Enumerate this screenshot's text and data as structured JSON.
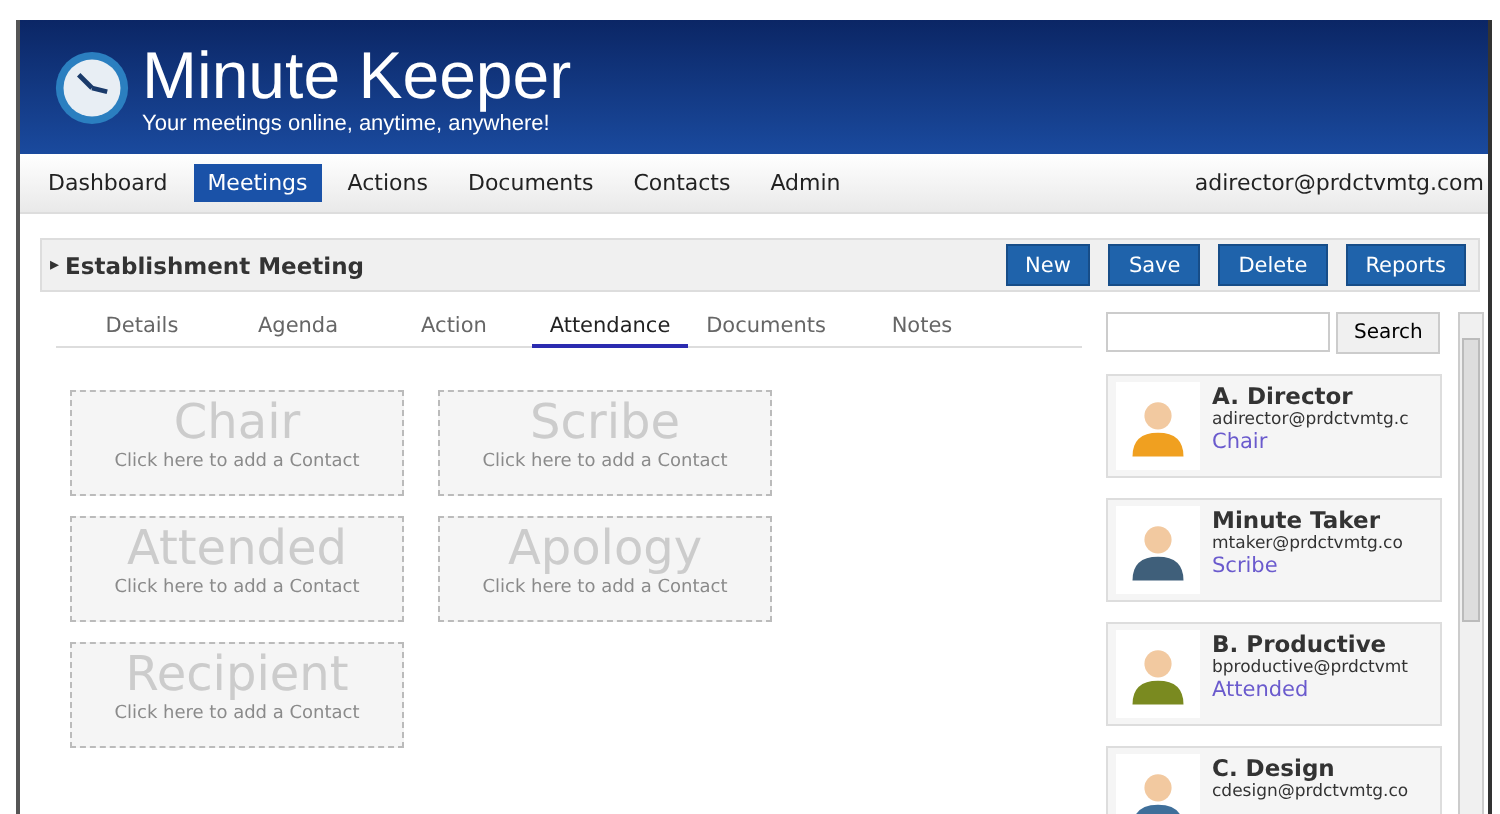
{
  "header": {
    "title": "Minute Keeper",
    "tagline": "Your meetings online, anytime, anywhere!"
  },
  "nav": {
    "items": [
      {
        "label": "Dashboard",
        "selected": false
      },
      {
        "label": "Meetings",
        "selected": true
      },
      {
        "label": "Actions",
        "selected": false
      },
      {
        "label": "Documents",
        "selected": false
      },
      {
        "label": "Contacts",
        "selected": false
      },
      {
        "label": "Admin",
        "selected": false
      }
    ],
    "user": "adirector@prdctvmtg.com"
  },
  "toolbar": {
    "toggle": "▸",
    "title": "Establishment Meeting",
    "buttons": [
      "New",
      "Save",
      "Delete",
      "Reports"
    ]
  },
  "tabs": [
    {
      "label": "Details",
      "selected": false
    },
    {
      "label": "Agenda",
      "selected": false
    },
    {
      "label": "Action",
      "selected": false
    },
    {
      "label": "Attendance",
      "selected": true
    },
    {
      "label": "Documents",
      "selected": false
    },
    {
      "label": "Notes",
      "selected": false
    }
  ],
  "slots": [
    {
      "title": "Chair",
      "hint": "Click here to add a Contact"
    },
    {
      "title": "Scribe",
      "hint": "Click here to add a Contact"
    },
    {
      "title": "Attended",
      "hint": "Click here to add a Contact"
    },
    {
      "title": "Apology",
      "hint": "Click here to add a Contact"
    },
    {
      "title": "Recipient",
      "hint": "Click here to add a Contact"
    }
  ],
  "contacts_panel": {
    "search_button": "Search",
    "contacts": [
      {
        "name": "A. Director",
        "email": "adirector@prdctvmtg.c",
        "role": "Chair",
        "color": "#f0a020"
      },
      {
        "name": "Minute Taker",
        "email": "mtaker@prdctvmtg.co",
        "role": "Scribe",
        "color": "#3f5f7a"
      },
      {
        "name": "B. Productive",
        "email": "bproductive@prdctvmt",
        "role": "Attended",
        "color": "#7a8a20"
      },
      {
        "name": "C. Design",
        "email": "cdesign@prdctvmtg.co",
        "color": "#3f6f9a"
      }
    ]
  }
}
